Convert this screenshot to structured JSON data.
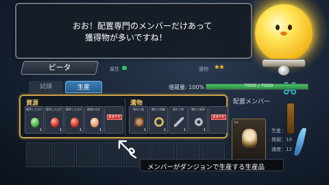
{
  "dialog": {
    "line1": "おお！配置専門のメンバーだけあって",
    "line2": "獲得物が多いですね！"
  },
  "character": {
    "name": "ピータ",
    "attribute_label": "属性",
    "relic_label": "遺物"
  },
  "tabs": [
    {
      "label": "試練",
      "active": false
    },
    {
      "label": "生産",
      "active": true
    }
  ],
  "storage": {
    "label": "埋蔵量: 100%",
    "value": "7000 / 7000",
    "fill_fraction": 1.0
  },
  "resources": {
    "title": "資源",
    "items": [
      {
        "label": "獲得した欠片",
        "count": "1",
        "icon": "green-gem"
      },
      {
        "label": "獲得した欠片",
        "count": "1",
        "icon": "red-gem"
      },
      {
        "label": "獲得した欠片",
        "count": "1",
        "icon": "red-gem"
      },
      {
        "label": "最優の欠片",
        "count": "1",
        "icon": "peach-gem"
      },
      {
        "label": "",
        "count": "",
        "icon": "lack-tag",
        "tag": "資源不足"
      }
    ]
  },
  "relics": {
    "title": "遺物",
    "items": [
      {
        "label": "壊れた鎧",
        "count": "1",
        "icon": "armor"
      },
      {
        "label": "壊れた指輪",
        "count": "1",
        "icon": "ring"
      },
      {
        "label": "壊れた剣",
        "count": "1",
        "icon": "sword"
      },
      {
        "label": "壊れた歯車",
        "count": "1",
        "icon": "gear"
      },
      {
        "label": "",
        "count": "",
        "icon": "lack-tag",
        "tag": "資源不足"
      }
    ]
  },
  "member": {
    "section_label": "配置メンバー",
    "level": "Lv",
    "stats": [
      "生産：",
      "発掘：10",
      "速度：12"
    ]
  },
  "hint": {
    "text": "メンバーがダンジョンで生産する生産品"
  },
  "colors": {
    "accent_gold": "#c9a24a",
    "tab_active": "#275b8a",
    "bar_green": "#4bc466",
    "lack_red": "#c02828"
  }
}
